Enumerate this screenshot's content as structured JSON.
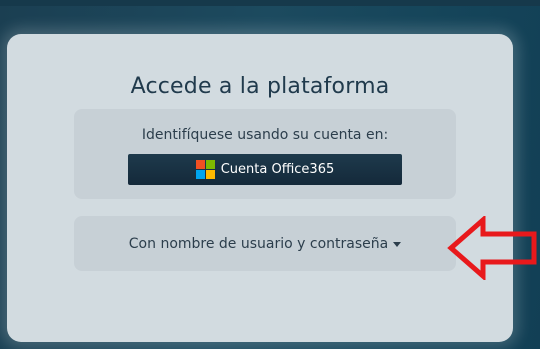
{
  "card": {
    "title": "Accede a la plataforma"
  },
  "office_panel": {
    "label": "Identifíquese usando su cuenta en:",
    "button_label": "Cuenta Office365",
    "logo_colors": [
      "#f25022",
      "#7fba00",
      "#00a4ef",
      "#ffb900"
    ]
  },
  "userpass_panel": {
    "label": "Con nombre de usuario y contraseña"
  },
  "annotation": {
    "arrow_color": "#e8191c"
  },
  "colors": {
    "background": "#1c4a5f",
    "card": "#d2dbe0",
    "panel": "#c7d0d6",
    "button": "#1e3a4c",
    "text": "#203a4c"
  }
}
